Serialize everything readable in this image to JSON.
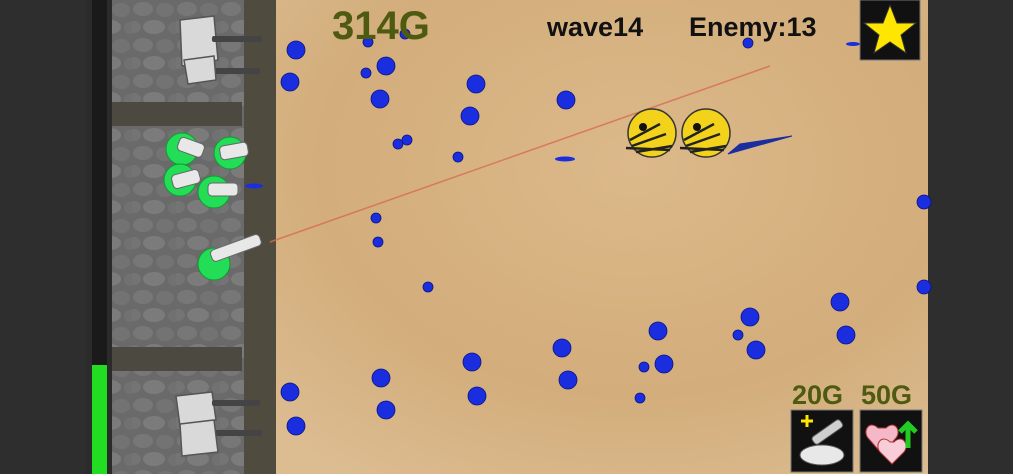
{
  "hud": {
    "gold": "314G",
    "wave": "wave14",
    "enemy_count": "Enemy:13",
    "special_icon": "star-icon"
  },
  "base": {
    "health_fraction": 0.23,
    "health_color": "#22dd22"
  },
  "shop": {
    "items": [
      {
        "cost": "20G",
        "icon": "add-turret-icon"
      },
      {
        "cost": "50G",
        "icon": "heal-hearts-icon"
      }
    ]
  },
  "colors": {
    "sand": "#d8b584",
    "wall": "#6b6b6b",
    "gold_text": "#4d5a10",
    "bullet": "#1a2ee0",
    "enemy": "#f2d21a",
    "soldier_ring": "#22dd55",
    "star": "#ffe600"
  }
}
